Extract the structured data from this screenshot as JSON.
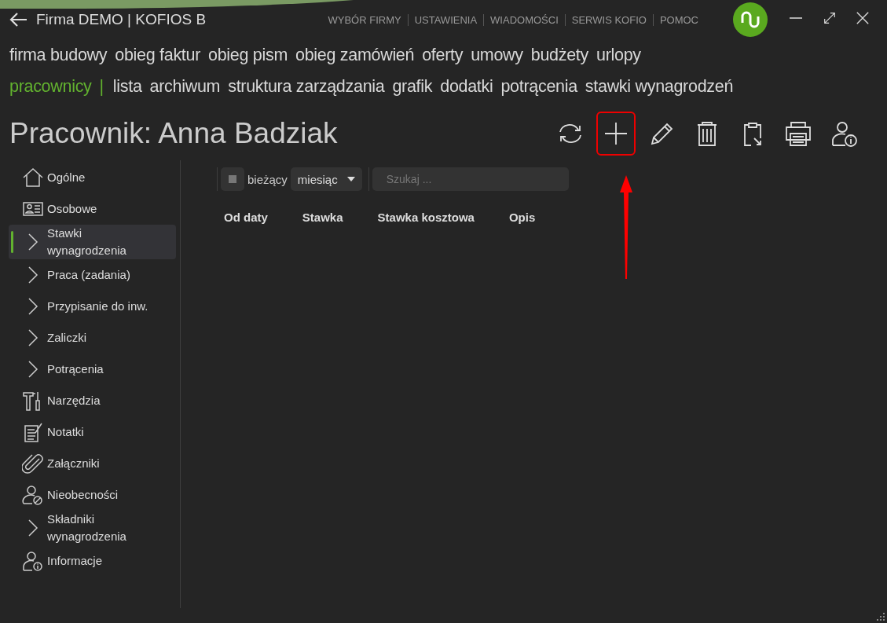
{
  "window": {
    "title": "Firma DEMO | KOFIOS B"
  },
  "top_links": [
    "WYBÓR FIRMY",
    "USTAWIENIA",
    "WIADOMOŚCI",
    "SERWIS KOFIO",
    "POMOC"
  ],
  "menu_row_1": [
    {
      "label": "firma budowy",
      "selected": false
    },
    {
      "label": "obieg faktur",
      "selected": false
    },
    {
      "label": "obieg pism",
      "selected": false
    },
    {
      "label": "obieg zamówień",
      "selected": false
    },
    {
      "label": "oferty",
      "selected": false
    },
    {
      "label": "umowy",
      "selected": false
    },
    {
      "label": "budżety",
      "selected": false
    },
    {
      "label": "urlopy",
      "selected": false
    }
  ],
  "menu_row_2": {
    "section": "pracownicy",
    "separator": "|",
    "items": [
      {
        "label": "lista",
        "selected": false
      },
      {
        "label": "archiwum",
        "selected": false
      },
      {
        "label": "struktura zarządzania",
        "selected": false
      },
      {
        "label": "grafik",
        "selected": false
      },
      {
        "label": "dodatki",
        "selected": false
      },
      {
        "label": "potrącenia",
        "selected": false
      },
      {
        "label": "stawki wynagrodzeń",
        "selected": false
      }
    ]
  },
  "page_title": "Pracownik: Anna Badziak",
  "toolbar": [
    {
      "kind": "refresh",
      "highlighted": false
    },
    {
      "kind": "add",
      "highlighted": true
    },
    {
      "kind": "edit",
      "highlighted": false
    },
    {
      "kind": "delete",
      "highlighted": false
    },
    {
      "kind": "clipboard",
      "highlighted": false
    },
    {
      "kind": "print",
      "highlighted": false
    },
    {
      "kind": "info",
      "highlighted": false
    }
  ],
  "sidebar": {
    "items": [
      {
        "kind": "home",
        "label": "Ogólne",
        "selected": false
      },
      {
        "kind": "card",
        "label": "Osobowe",
        "selected": false
      },
      {
        "kind": "chevron",
        "label": "Stawki\nwynagrodzenia",
        "selected": true
      },
      {
        "kind": "chevron",
        "label": "Praca (zadania)",
        "selected": false
      },
      {
        "kind": "chevron",
        "label": "Przypisanie do inw.",
        "selected": false
      },
      {
        "kind": "chevron",
        "label": "Zaliczki",
        "selected": false
      },
      {
        "kind": "chevron",
        "label": "Potrącenia",
        "selected": false
      },
      {
        "kind": "tools",
        "label": "Narzędzia",
        "selected": false
      },
      {
        "kind": "note",
        "label": "Notatki",
        "selected": false
      },
      {
        "kind": "clip",
        "label": "Załączniki",
        "selected": false
      },
      {
        "kind": "absence",
        "label": "Nieobecności",
        "selected": false
      },
      {
        "kind": "chevron",
        "label": "Składniki\nwynagrodzenia",
        "selected": false
      },
      {
        "kind": "info",
        "label": "Informacje",
        "selected": false
      }
    ]
  },
  "filter": {
    "current": {
      "label": "bieżący",
      "checked": true
    },
    "period": {
      "value": "miesiąc"
    },
    "search": {
      "placeholder": "Szukaj ..."
    }
  },
  "table": {
    "columns": [
      "Od daty",
      "Stawka",
      "Stawka kosztowa",
      "Opis"
    ]
  }
}
